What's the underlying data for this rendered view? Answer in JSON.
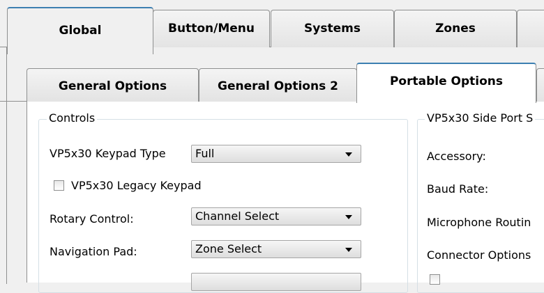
{
  "main_tabs": [
    "Global",
    "Button/Menu",
    "Systems",
    "Zones",
    ""
  ],
  "sub_tabs": [
    "General Options",
    "General Options 2",
    "Portable Options"
  ],
  "controls": {
    "title": "Controls",
    "keypad_type_label": "VP5x30 Keypad Type",
    "keypad_type_value": "Full",
    "legacy_keypad_label": "VP5x30 Legacy Keypad",
    "legacy_keypad_checked": false,
    "rotary_label": "Rotary Control:",
    "rotary_value": "Channel Select",
    "nav_pad_label": "Navigation Pad:",
    "nav_pad_value": "Zone Select",
    "row5_value": ""
  },
  "side_port": {
    "title": "VP5x30 Side Port S",
    "accessory_label": "Accessory:",
    "baud_label": "Baud Rate:",
    "mic_label": "Microphone Routin",
    "connector_label": "Connector Options"
  }
}
